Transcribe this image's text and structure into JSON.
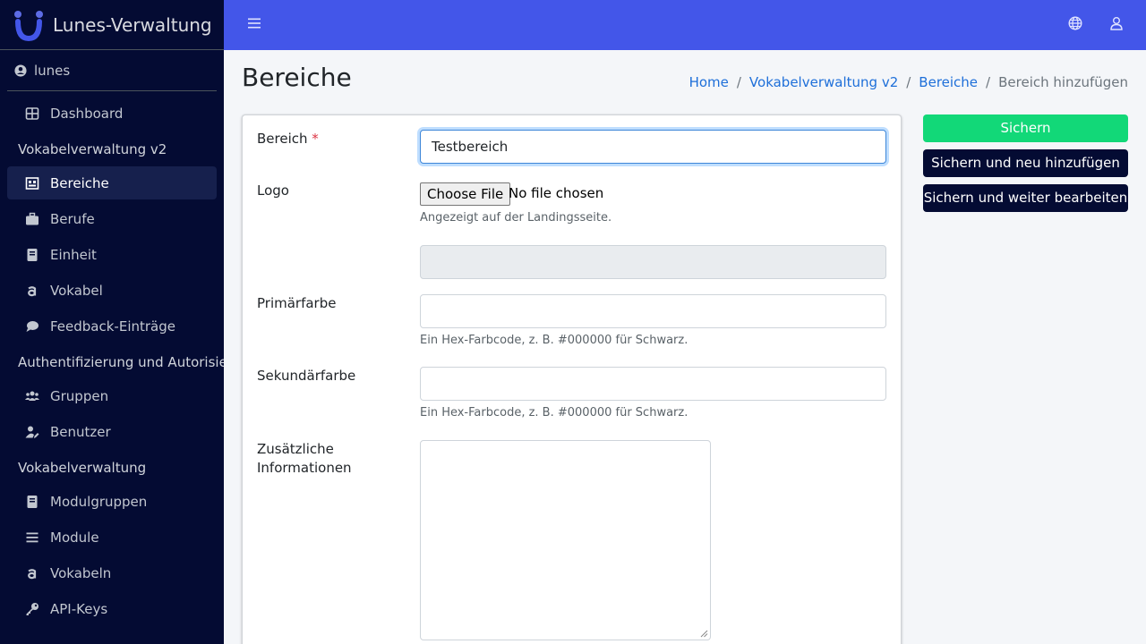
{
  "brand": {
    "name": "Lunes-Verwaltung"
  },
  "user": {
    "name": "lunes"
  },
  "sidebar": {
    "sections": [
      {
        "header": "",
        "items": [
          {
            "label": "Dashboard",
            "icon": "dashboard-icon"
          }
        ]
      },
      {
        "header": "Vokabelverwaltung v2",
        "items": [
          {
            "label": "Bereiche",
            "icon": "gallery-icon",
            "active": true
          },
          {
            "label": "Berufe",
            "icon": "briefcase-icon"
          },
          {
            "label": "Einheit",
            "icon": "book-icon"
          },
          {
            "label": "Vokabel",
            "icon": "letter-a-icon"
          },
          {
            "label": "Feedback-Einträge",
            "icon": "comment-icon"
          }
        ]
      },
      {
        "header": "Authentifizierung und Autorisierung",
        "items": [
          {
            "label": "Gruppen",
            "icon": "users-icon"
          },
          {
            "label": "Benutzer",
            "icon": "user-edit-icon"
          }
        ]
      },
      {
        "header": "Vokabelverwaltung",
        "items": [
          {
            "label": "Modulgruppen",
            "icon": "book-icon"
          },
          {
            "label": "Module",
            "icon": "list-icon"
          },
          {
            "label": "Vokabeln",
            "icon": "letter-a-icon"
          },
          {
            "label": "API-Keys",
            "icon": "key-icon"
          }
        ]
      }
    ]
  },
  "page": {
    "title": "Bereiche"
  },
  "breadcrumb": {
    "home": "Home",
    "level1": "Vokabelverwaltung v2",
    "level2": "Bereiche",
    "current": "Bereich hinzufügen",
    "separator": "/"
  },
  "form": {
    "bereich": {
      "label": "Bereich",
      "required_mark": "*",
      "value": "Testbereich"
    },
    "logo": {
      "label": "Logo",
      "button": "Choose File",
      "status": "No file chosen",
      "help": "Angezeigt auf der Landingsseite."
    },
    "primary": {
      "label": "Primärfarbe",
      "value": "",
      "help": "Ein Hex-Farbcode, z. B. #000000 für Schwarz."
    },
    "secondary": {
      "label": "Sekundärfarbe",
      "value": "",
      "help": "Ein Hex-Farbcode, z. B. #000000 für Schwarz."
    },
    "info": {
      "label_line1": "Zusätzliche",
      "label_line2": "Informationen"
    }
  },
  "actions": {
    "save": "Sichern",
    "save_add": "Sichern und neu hinzufügen",
    "save_continue": "Sichern und weiter bearbeiten"
  },
  "colors": {
    "sidebar": "#040b33",
    "topbar": "#4356e9",
    "save": "#12d878",
    "link": "#1e6fd9"
  }
}
